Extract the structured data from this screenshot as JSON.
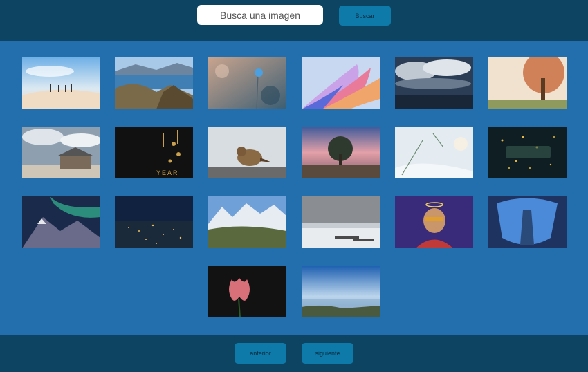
{
  "search": {
    "placeholder": "Busca una imagen",
    "button_label": "Buscar"
  },
  "pagination": {
    "prev_label": "anterior",
    "next_label": "siguiente"
  },
  "images": [
    {
      "name": "beach-family-image"
    },
    {
      "name": "lake-mountains-image"
    },
    {
      "name": "flower-bokeh-image"
    },
    {
      "name": "abstract-waves-image"
    },
    {
      "name": "storm-clouds-image"
    },
    {
      "name": "autumn-tree-image"
    },
    {
      "name": "cabin-clouds-image"
    },
    {
      "name": "new-year-2022-image"
    },
    {
      "name": "bird-image"
    },
    {
      "name": "tree-sunset-image"
    },
    {
      "name": "snowy-branch-image"
    },
    {
      "name": "fireworks-2022-image"
    },
    {
      "name": "aurora-mountains-image"
    },
    {
      "name": "night-city-image"
    },
    {
      "name": "snowy-peaks-image"
    },
    {
      "name": "winter-dock-image"
    },
    {
      "name": "ape-cartoon-image"
    },
    {
      "name": "skyscraper-fisheye-image"
    },
    {
      "name": "tulip-image"
    },
    {
      "name": "coastal-sky-image"
    }
  ],
  "colors": {
    "background": "#236fae",
    "header": "#0d4462",
    "button": "#0e7aa9"
  }
}
